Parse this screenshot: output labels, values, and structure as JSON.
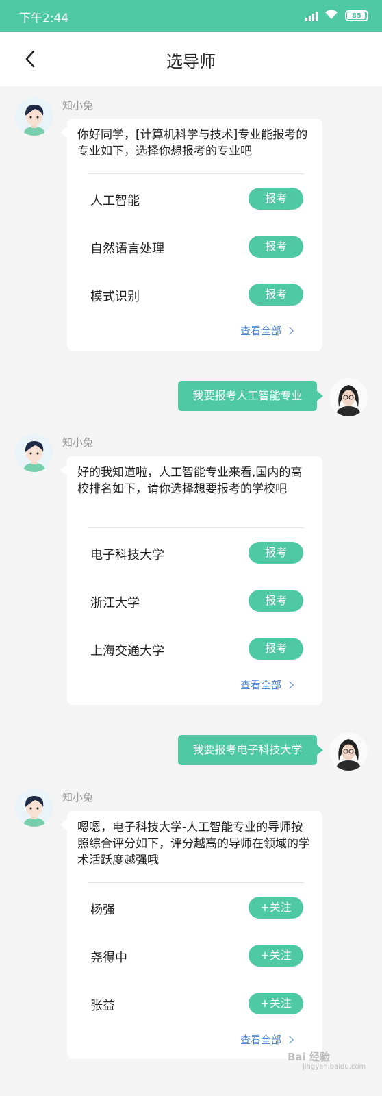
{
  "status_bar": {
    "time": "下午2:44",
    "battery": "85"
  },
  "header": {
    "title": "选导师"
  },
  "messages": [
    {
      "sender": "知小兔",
      "text": "你好同学，[计算机科学与技术]专业能报考的专业如下，选择你想报考的专业吧",
      "options": [
        {
          "label": "人工智能",
          "action": "报考"
        },
        {
          "label": "自然语言处理",
          "action": "报考"
        },
        {
          "label": "模式识别",
          "action": "报考"
        }
      ],
      "view_all": "查看全部"
    },
    {
      "user_text": "我要报考人工智能专业"
    },
    {
      "sender": "知小兔",
      "text": "好的我知道啦，人工智能专业来看,国内的高校排名如下，请你选择想要报考的学校吧",
      "options": [
        {
          "label": "电子科技大学",
          "action": "报考"
        },
        {
          "label": "浙江大学",
          "action": "报考"
        },
        {
          "label": "上海交通大学",
          "action": "报考"
        }
      ],
      "view_all": "查看全部"
    },
    {
      "user_text": "我要报考电子科技大学"
    },
    {
      "sender": "知小兔",
      "text": "嗯嗯，电子科技大学-人工智能专业的导师按照综合评分如下，评分越高的导师在领域的学术活跃度越强哦",
      "options": [
        {
          "label": "杨强",
          "action": "+关注"
        },
        {
          "label": "尧得中",
          "action": "+关注"
        },
        {
          "label": "张益",
          "action": "+关注"
        }
      ],
      "view_all": "查看全部"
    }
  ],
  "watermark": {
    "main": "Bai 经验",
    "sub": "jingyan.baidu.com"
  },
  "colors": {
    "brand": "#4ec9a4",
    "link": "#4a86d4",
    "background": "#f4f4f4"
  }
}
